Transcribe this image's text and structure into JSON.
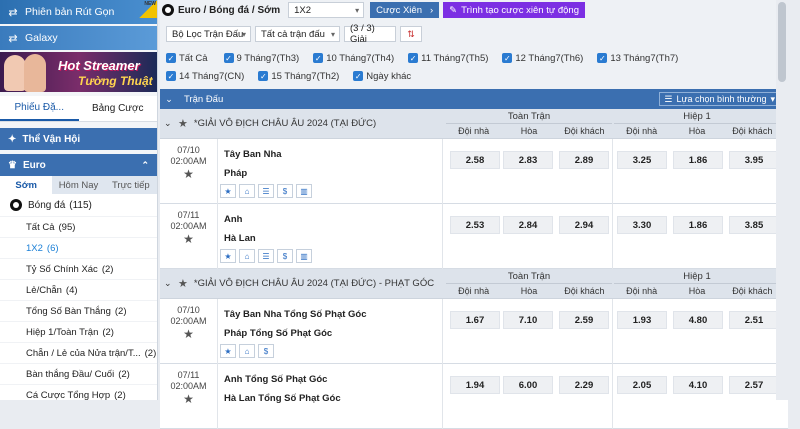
{
  "sidebar": {
    "promo1": "Phiên bản Rút Gọn",
    "new_badge": "NEW",
    "promo2": "Galaxy",
    "banner_line1": "Hot Streamer",
    "banner_line2": "Tường Thuật",
    "tab_slip": "Phiếu Đặ...",
    "tab_bets": "Bảng Cược",
    "section_sports": "Thể Vận Hội",
    "section_euro": "Euro",
    "periods": [
      "Sớm",
      "Hôm Nay",
      "Trực tiếp"
    ],
    "sport_label": "Bóng đá",
    "sport_count": "(115)",
    "bet_types": [
      {
        "label": "Tất Cả",
        "count": "(95)"
      },
      {
        "label": "1X2",
        "count": "(6)"
      },
      {
        "label": "Tỷ Số Chính Xác",
        "count": "(2)"
      },
      {
        "label": "Lẻ/Chẵn",
        "count": "(4)"
      },
      {
        "label": "Tổng Số Bàn Thắng",
        "count": "(2)"
      },
      {
        "label": "Hiệp 1/Toàn Trận",
        "count": "(2)"
      },
      {
        "label": "Chẵn / Lẻ của Nửa trận/T...",
        "count": "(2)"
      },
      {
        "label": "Bàn thắng Đầu/ Cuối",
        "count": "(2)"
      },
      {
        "label": "Cá Cược Tổng Hợp",
        "count": "(2)"
      }
    ]
  },
  "header": {
    "breadcrumb": "Euro / Bóng đá / Sớm",
    "market_select": "1X2",
    "combo_button": "Cược Xiên",
    "create_combo_button": "Trình tạo cược xiên tự động",
    "filter_match": "Bộ Lọc Trận Đấu",
    "filter_all": "Tất cả trận đấu",
    "filter_league": "(3 / 3) Giải"
  },
  "dates": [
    "Tất Cả",
    "9 Tháng7(Th3)",
    "10 Tháng7(Th4)",
    "11 Tháng7(Th5)",
    "12 Tháng7(Th6)",
    "13 Tháng7(Th7)",
    "14 Tháng7(CN)",
    "15 Tháng7(Th2)",
    "Ngày khác"
  ],
  "table": {
    "header_label": "Trận Đấu",
    "view_select": "Lựa chọn bình thường",
    "full_match": "Toàn Trận",
    "half1": "Hiệp 1",
    "col_home": "Đội nhà",
    "col_draw": "Hòa",
    "col_away": "Đội khách"
  },
  "leagues": [
    {
      "name": "*GIẢI VÔ ĐỊCH CHÂU ÂU 2024 (TẠI ĐỨC)",
      "matches": [
        {
          "date": "07/10",
          "time": "02:00AM",
          "home": "Tây Ban Nha",
          "away": "Pháp",
          "odds": [
            "2.58",
            "2.83",
            "2.89",
            "3.25",
            "1.86",
            "3.95"
          ],
          "icons": [
            "★",
            "⌂",
            "☰",
            "$",
            "▥"
          ]
        },
        {
          "date": "07/11",
          "time": "02:00AM",
          "home": "Anh",
          "away": "Hà Lan",
          "odds": [
            "2.53",
            "2.84",
            "2.94",
            "3.30",
            "1.86",
            "3.85"
          ],
          "icons": [
            "★",
            "⌂",
            "☰",
            "$",
            "▥"
          ]
        }
      ]
    },
    {
      "name": "*GIẢI VÔ ĐỊCH CHÂU ÂU 2024 (TẠI ĐỨC) - PHẠT GÓC",
      "matches": [
        {
          "date": "07/10",
          "time": "02:00AM",
          "home": "Tây Ban Nha Tổng Số Phạt Góc",
          "away": "Pháp Tổng Số Phạt Góc",
          "odds": [
            "1.67",
            "7.10",
            "2.59",
            "1.93",
            "4.80",
            "2.51"
          ],
          "icons": [
            "★",
            "⌂",
            "$"
          ]
        },
        {
          "date": "07/11",
          "time": "02:00AM",
          "home": "Anh Tổng Số Phạt Góc",
          "away": "Hà Lan Tổng Số Phạt Góc",
          "odds": [
            "1.94",
            "6.00",
            "2.29",
            "2.05",
            "4.10",
            "2.57"
          ],
          "icons": []
        }
      ]
    }
  ],
  "colors": {
    "primary": "#3b6fb0",
    "purple": "#7c2fe3",
    "checkbox": "#2a7bd1"
  }
}
